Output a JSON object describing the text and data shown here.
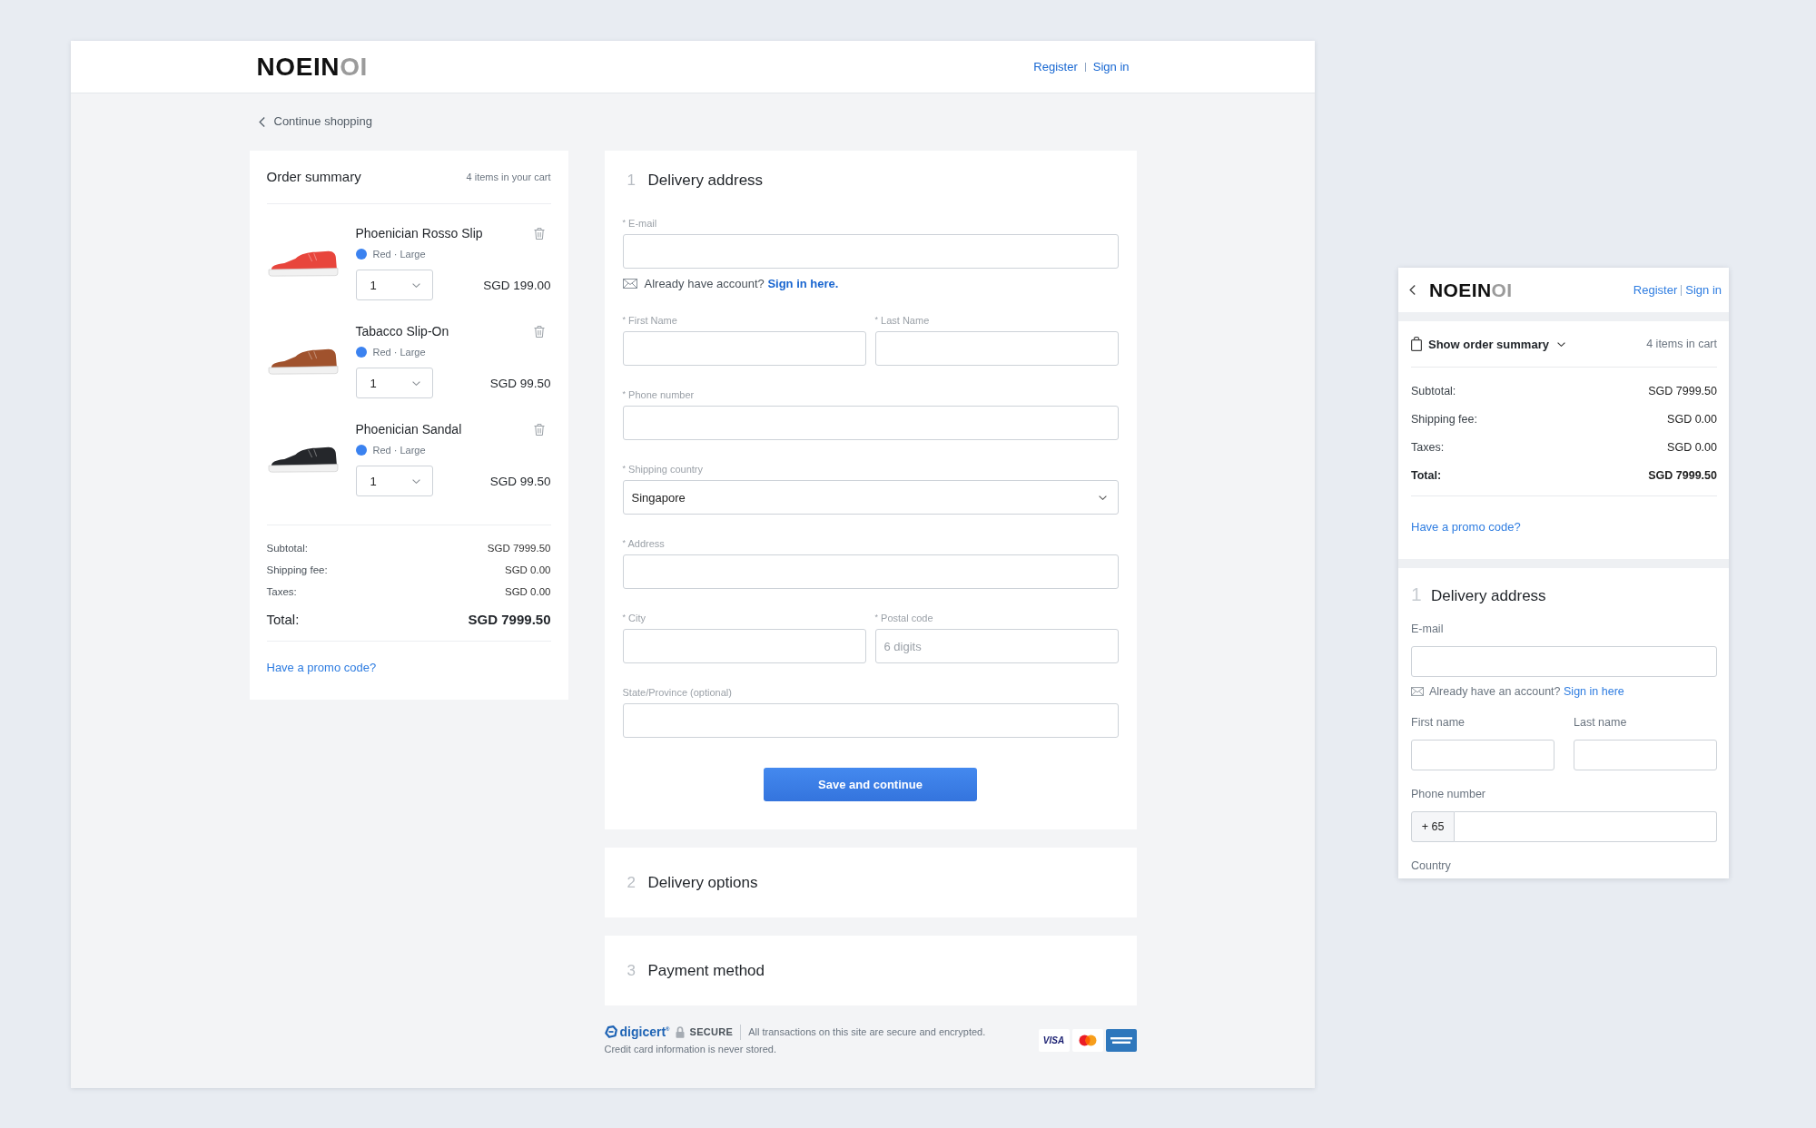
{
  "header": {
    "logo": {
      "main": "NOEIN",
      "light": "OI"
    },
    "links": [
      "Register",
      "Sign in"
    ]
  },
  "back_link": "Continue shopping",
  "order_summary": {
    "title": "Order summary",
    "count": "4 items in your cart",
    "items": [
      {
        "name": "Phoenician Rosso Slip",
        "variant": "Red · Large",
        "color": "#e8453c",
        "quantity": "1",
        "price": "SGD 199.00"
      },
      {
        "name": "Tabacco Slip-On",
        "variant": "Red · Large",
        "color": "#a0522d",
        "quantity": "1",
        "price": "SGD 99.50"
      },
      {
        "name": "Phoenician Sandal",
        "variant": "Red · Large",
        "color": "#25272b",
        "quantity": "1",
        "price": "SGD 99.50"
      }
    ],
    "totals": [
      {
        "label": "Subtotal:",
        "value": "SGD 7999.50",
        "kind": "line"
      },
      {
        "label": "Shipping fee:",
        "value": "SGD 0.00",
        "kind": "line"
      },
      {
        "label": "Taxes:",
        "value": "SGD 0.00",
        "kind": "line"
      },
      {
        "label": "Total:",
        "value": "SGD 7999.50",
        "kind": "total"
      }
    ],
    "promo": "Have a promo code?"
  },
  "checkout": {
    "steps": [
      {
        "number": "1",
        "title": "Delivery address",
        "expanded": true,
        "form": {
          "rows": [
            {
              "fields": [
                {
                  "label": "$^{*}$ E-mail",
                  "kind": "text"
                }
              ],
              "hint": {
                "text": "Already have account?",
                "link": "Sign in here."
              }
            },
            {
              "fields": [
                {
                  "label": "$^{*}$ First Name",
                  "kind": "text"
                },
                {
                  "label": "$^{*}$ Last Name",
                  "kind": "text"
                }
              ]
            },
            {
              "fields": [
                {
                  "label": "$^{*}$ Phone number",
                  "kind": "text"
                }
              ]
            },
            {
              "fields": [
                {
                  "label": "$^{*}$ Shipping country",
                  "kind": "select",
                  "value": "Singapore"
                }
              ]
            },
            {
              "fields": [
                {
                  "label": "$^{*}$ Address",
                  "kind": "text"
                }
              ]
            },
            {
              "fields": [
                {
                  "label": "$^{*}$ City",
                  "kind": "text"
                },
                {
                  "label": "$^{*}$ Postal code",
                  "kind": "text",
                  "placeholder": "6 digits"
                }
              ]
            },
            {
              "fields": [
                {
                  "label": "State/Province (optional)",
                  "kind": "text"
                }
              ]
            }
          ],
          "button": "Save and continue"
        }
      },
      {
        "number": "2",
        "title": "Delivery options",
        "expanded": false
      },
      {
        "number": "3",
        "title": "Payment method",
        "expanded": false
      }
    ]
  },
  "security": {
    "brand": "digicert$^{®}$",
    "badge": "SECURE",
    "lines": [
      "All transactions on this site are secure and encrypted.",
      "Credit card information is never stored."
    ],
    "cards": [
      {
        "kind": "visa",
        "text": "VISA"
      },
      {
        "kind": "mastercard"
      },
      {
        "kind": "amex"
      }
    ]
  },
  "mobile": {
    "logo": {
      "main": "NOEIN",
      "light": "OI"
    },
    "links": [
      "Register",
      "Sign in"
    ],
    "summary": {
      "toggle": "Show order summary",
      "expanded": false,
      "count": "4 items in cart",
      "totals": [
        {
          "label": "Subtotal:",
          "value": "SGD 7999.50",
          "kind": "line"
        },
        {
          "label": "Shipping fee:",
          "value": "SGD 0.00",
          "kind": "line"
        },
        {
          "label": "Taxes:",
          "value": "SGD 0.00",
          "kind": "line"
        },
        {
          "label": "Total:",
          "value": "SGD 7999.50",
          "kind": "total"
        }
      ],
      "promo": "Have a promo code?"
    },
    "step": {
      "number": "1",
      "title": "Delivery address",
      "rows": [
        {
          "fields": [
            {
              "label": "E-mail",
              "kind": "text"
            }
          ],
          "hint": {
            "text": "Already have an account?",
            "link": "Sign in here"
          }
        },
        {
          "fields": [
            {
              "label": "First name",
              "kind": "text"
            },
            {
              "label": "Last name",
              "kind": "text"
            }
          ]
        },
        {
          "fields": [
            {
              "label": "Phone number",
              "kind": "phone",
              "prefix": "+ 65"
            }
          ]
        },
        {
          "fields": [
            {
              "label": "Country",
              "kind": "label"
            }
          ]
        }
      ]
    }
  }
}
